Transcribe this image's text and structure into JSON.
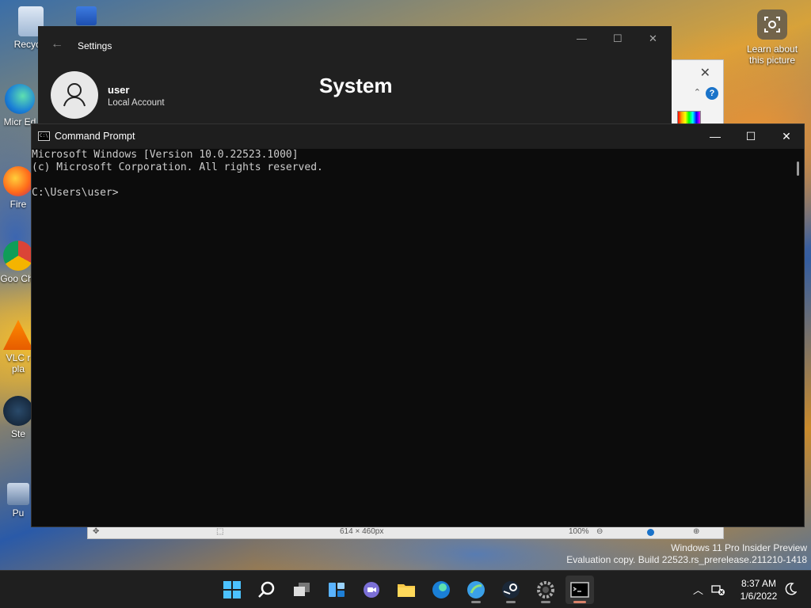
{
  "desktop": {
    "icons": [
      {
        "label": "Recycle"
      },
      {
        "label": "Micr Ed"
      },
      {
        "label": "Fire"
      },
      {
        "label": "Goo Chr"
      },
      {
        "label": "VLC r pla"
      },
      {
        "label": "Ste"
      },
      {
        "label": "Pu"
      }
    ],
    "learn_label": "Learn about this picture",
    "watermark_line1": "Windows 11 Pro Insider Preview",
    "watermark_line2": "Evaluation copy. Build 22523.rs_prerelease.211210-1418"
  },
  "photo_viewer": {
    "status_size": "614 × 460px",
    "status_zoom": "100%"
  },
  "settings": {
    "title": "Settings",
    "user_name": "user",
    "account_type": "Local Account",
    "section": "System"
  },
  "cmd": {
    "title": "Command Prompt",
    "line1": "Microsoft Windows [Version 10.0.22523.1000]",
    "line2": "(c) Microsoft Corporation. All rights reserved.",
    "line3": "",
    "prompt": "C:\\Users\\user>"
  },
  "taskbar": {
    "apps": [
      "start-icon",
      "search-icon",
      "task-view-icon",
      "widgets-icon",
      "chat-icon",
      "file-explorer-icon",
      "edge-icon",
      "browser-icon",
      "steam-icon",
      "settings-icon",
      "command-prompt-icon"
    ],
    "time": "8:37 AM",
    "date": "1/6/2022"
  },
  "colors": {
    "cmd_bg": "#0c0c0c",
    "cmd_text": "#cccccc",
    "settings_bg": "#202020",
    "taskbar_bg": "#1f1f1f",
    "active_indicator": "#d9826a"
  }
}
